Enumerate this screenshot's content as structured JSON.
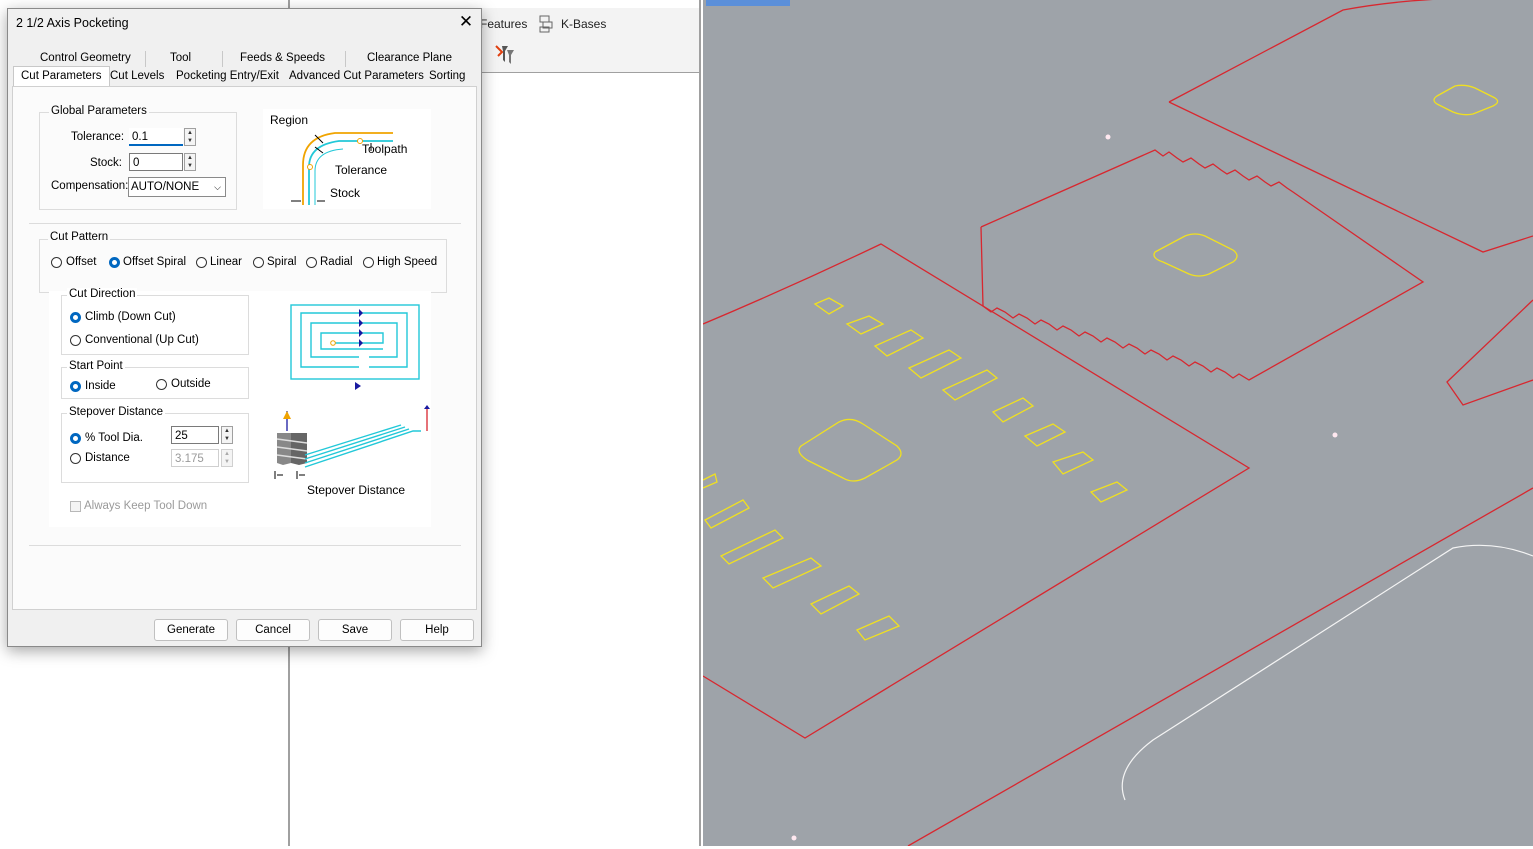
{
  "background": {
    "toolbar": {
      "features_label": "Features",
      "kbases_label": "K-Bases"
    }
  },
  "dialog": {
    "title": "2 1/2 Axis Pocketing",
    "tabs_top": [
      "Control Geometry",
      "Tool",
      "Feeds & Speeds",
      "Clearance Plane"
    ],
    "tabs_bottom": [
      "Cut Parameters",
      "Cut Levels",
      "Pocketing Entry/Exit",
      "Advanced Cut Parameters",
      "Sorting"
    ],
    "global": {
      "title": "Global Parameters",
      "tolerance_label": "Tolerance:",
      "tolerance_value": "0.1",
      "stock_label": "Stock:",
      "stock_value": "0",
      "compensation_label": "Compensation:",
      "compensation_value": "AUTO/NONE"
    },
    "region_diagram": {
      "region": "Region",
      "toolpath": "Toolpath",
      "tolerance": "Tolerance",
      "stock": "Stock"
    },
    "cut_pattern": {
      "title": "Cut Pattern",
      "options": [
        "Offset",
        "Offset Spiral",
        "Linear",
        "Spiral",
        "Radial",
        "High Speed"
      ],
      "selected": "Offset Spiral"
    },
    "cut_direction": {
      "title": "Cut Direction",
      "options": [
        "Climb (Down Cut)",
        "Conventional (Up Cut)"
      ],
      "selected": "Climb (Down Cut)"
    },
    "start_point": {
      "title": "Start Point",
      "options": [
        "Inside",
        "Outside"
      ],
      "selected": "Inside"
    },
    "stepover": {
      "title": "Stepover Distance",
      "tool_dia_label": "% Tool Dia.",
      "tool_dia_value": "25",
      "distance_label": "Distance",
      "distance_value": "3.175",
      "selected": "% Tool Dia.",
      "diagram_label": "Stepover Distance"
    },
    "always_keep_tool_down": {
      "label": "Always Keep Tool Down",
      "checked": false
    },
    "buttons": {
      "generate": "Generate",
      "cancel": "Cancel",
      "save": "Save",
      "help": "Help"
    }
  },
  "colors": {
    "accent": "#0067c0",
    "viewport_bg": "#9ea3a9",
    "curve_red": "#d8272f",
    "curve_yellow": "#f0e020",
    "toolpath_cyan": "#22c8d8",
    "region_orange": "#f0a400"
  }
}
